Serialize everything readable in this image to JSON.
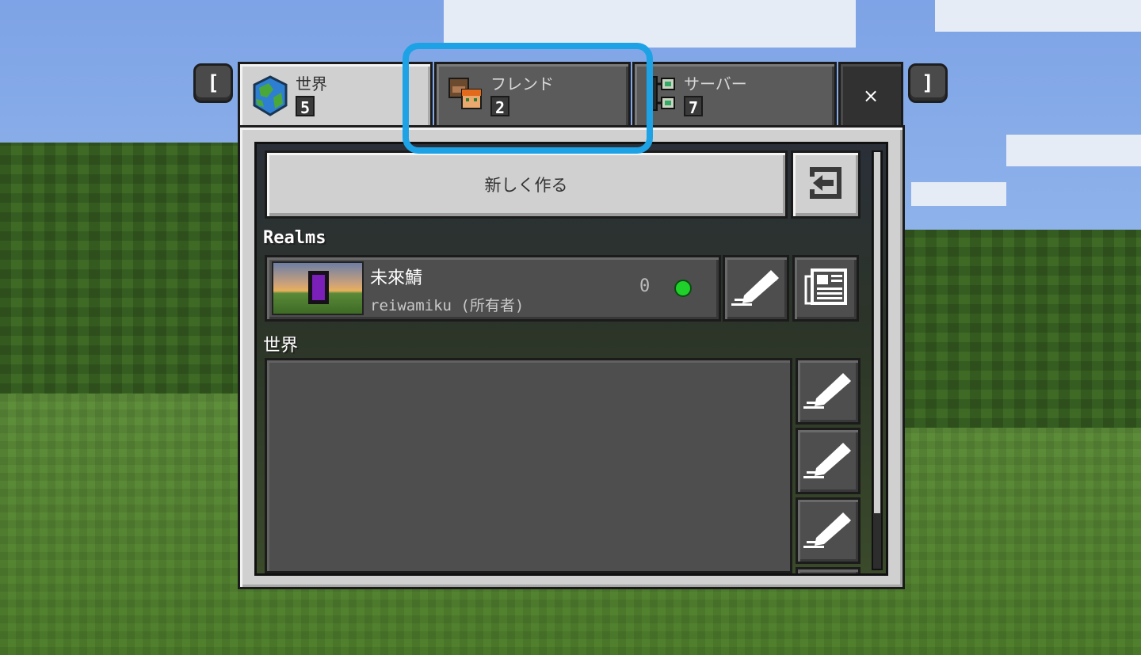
{
  "bumpers": {
    "left": "[",
    "right": "]"
  },
  "tabs": [
    {
      "label": "世界",
      "count": "5",
      "icon": "globe-icon",
      "active": true
    },
    {
      "label": "フレンド",
      "count": "2",
      "icon": "friends-icon",
      "active": false
    },
    {
      "label": "サーバー",
      "count": "7",
      "icon": "server-icon",
      "active": false
    }
  ],
  "close_label": "×",
  "create_label": "新しく作る",
  "import_icon": "import-icon",
  "realms_section": "Realms",
  "realm": {
    "name": "未來鯖",
    "owner": "reiwamiku (所有者)",
    "players": "0",
    "status_color": "#1fd12a"
  },
  "worlds_section": "世界",
  "colors": {
    "panel": "#d0d0d1",
    "dark_button": "#4e4e4e",
    "highlight": "#1ea2e6"
  }
}
